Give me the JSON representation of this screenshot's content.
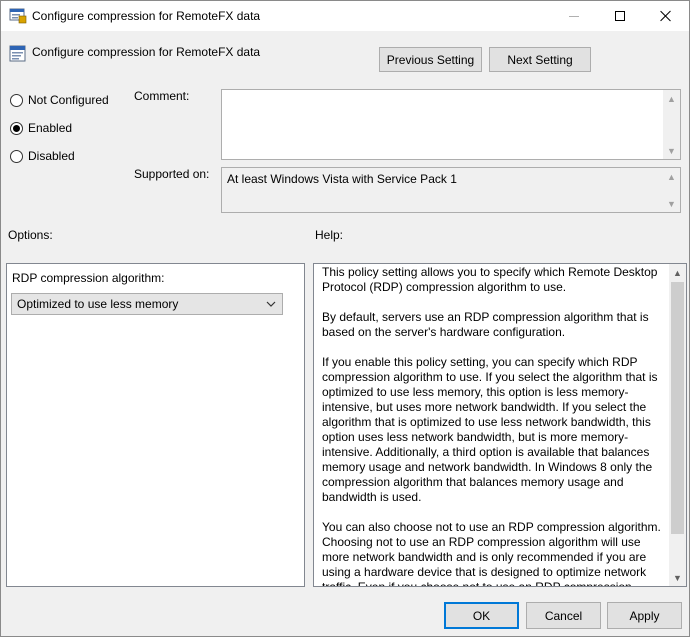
{
  "window": {
    "title": "Configure compression for RemoteFX data",
    "policy_name": "Configure compression for RemoteFX data"
  },
  "nav": {
    "previous_label": "Previous Setting",
    "next_label": "Next Setting"
  },
  "state": {
    "options": [
      {
        "label": "Not Configured",
        "checked": false
      },
      {
        "label": "Enabled",
        "checked": true
      },
      {
        "label": "Disabled",
        "checked": false
      }
    ]
  },
  "comment": {
    "label": "Comment:",
    "value": ""
  },
  "supported": {
    "label": "Supported on:",
    "value": "At least Windows Vista with Service Pack 1"
  },
  "options_section": {
    "label": "Options:",
    "field_label": "RDP compression algorithm:",
    "selected_value": "Optimized to use less memory"
  },
  "help_section": {
    "label": "Help:",
    "paragraphs": [
      "This policy setting allows you to specify which Remote Desktop Protocol (RDP) compression algorithm to use.",
      "By default, servers use an RDP compression algorithm that is based on the server's hardware configuration.",
      "If you enable this policy setting, you can specify which RDP compression algorithm to use. If you select the algorithm that is optimized to use less memory, this option is less memory-intensive, but uses more network bandwidth. If you select the algorithm that is optimized to use less network bandwidth, this option uses less network bandwidth, but is more memory-intensive. Additionally, a third option is available that balances memory usage and network bandwidth. In Windows  8 only the compression algorithm that balances memory usage and bandwidth is used.",
      "You can also choose not to use an RDP compression algorithm. Choosing not to use an RDP compression algorithm will use more network bandwidth and is only recommended if you are using a hardware device that is designed to optimize network traffic. Even if you choose not to use an RDP compression algorithm, some graphics data will still be compressed."
    ]
  },
  "footer": {
    "ok_label": "OK",
    "cancel_label": "Cancel",
    "apply_label": "Apply"
  },
  "colors": {
    "window_bg": "#f0f0f0",
    "focus_border": "#0078d7"
  },
  "icons": {
    "title": "policy-settings-icon",
    "policy": "policy-settings-icon",
    "select": "chevron-down-icon"
  }
}
